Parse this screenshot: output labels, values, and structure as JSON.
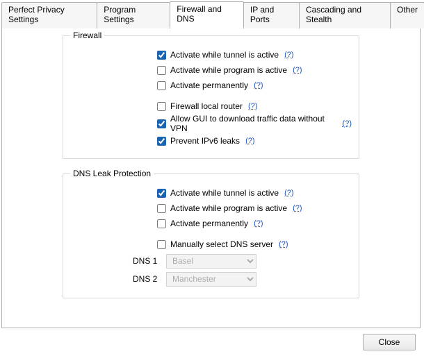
{
  "tabs": [
    {
      "label": "Perfect Privacy Settings",
      "active": false
    },
    {
      "label": "Program Settings",
      "active": false
    },
    {
      "label": "Firewall and DNS",
      "active": true
    },
    {
      "label": "IP and Ports",
      "active": false
    },
    {
      "label": "Cascading and Stealth",
      "active": false
    },
    {
      "label": "Other",
      "active": false
    }
  ],
  "help_glyph": "(?)",
  "firewall": {
    "legend": "Firewall",
    "activate_tunnel": {
      "label": "Activate while tunnel is active",
      "checked": true
    },
    "activate_program": {
      "label": "Activate while program is active",
      "checked": false
    },
    "activate_perm": {
      "label": "Activate permanently",
      "checked": false
    },
    "local_router": {
      "label": "Firewall local router",
      "checked": false
    },
    "gui_dl": {
      "label": "Allow GUI to download traffic data without VPN",
      "checked": true
    },
    "ipv6": {
      "label": "Prevent IPv6 leaks",
      "checked": true
    }
  },
  "dns": {
    "legend": "DNS Leak Protection",
    "activate_tunnel": {
      "label": "Activate while tunnel is active",
      "checked": true
    },
    "activate_program": {
      "label": "Activate while program is active",
      "checked": false
    },
    "activate_perm": {
      "label": "Activate permanently",
      "checked": false
    },
    "manual": {
      "label": "Manually select DNS server",
      "checked": false
    },
    "dns1_label": "DNS 1",
    "dns2_label": "DNS 2",
    "dns1_value": "Basel",
    "dns2_value": "Manchester"
  },
  "close_label": "Close"
}
